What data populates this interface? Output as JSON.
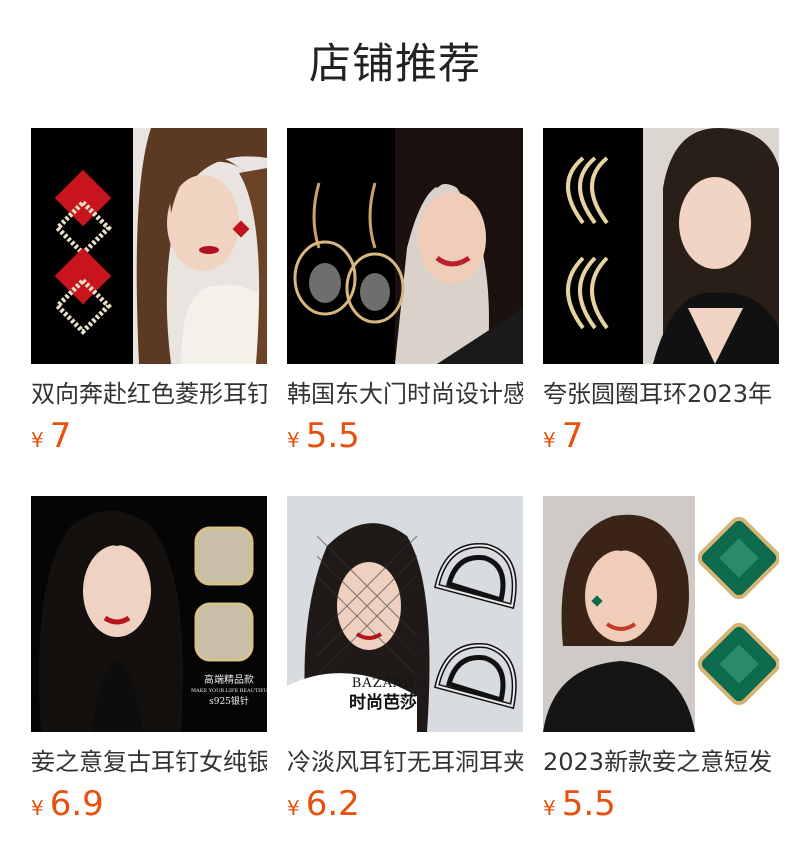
{
  "section_title": "店铺推荐",
  "currency_symbol": "¥",
  "products": [
    {
      "name": "双向奔赴红色菱形耳钉",
      "price": "7"
    },
    {
      "name": "韩国东大门时尚设计感",
      "price": "5.5"
    },
    {
      "name": "夸张圆圈耳环2023年",
      "price": "7"
    },
    {
      "name": "妾之意复古耳钉女纯银",
      "price": "6.9",
      "watermark_lines": [
        "高端精品款",
        "MAKE YOUR LIFE BEAUTIFUL",
        "s925银针"
      ]
    },
    {
      "name": "冷淡风耳钉无耳洞耳夹",
      "price": "6.2",
      "watermark_lines": [
        "BAZAAR",
        "时尚芭莎"
      ]
    },
    {
      "name": "2023新款妾之意短发",
      "price": "5.5"
    }
  ],
  "colors": {
    "price": "#e8500e",
    "title": "#222222"
  }
}
